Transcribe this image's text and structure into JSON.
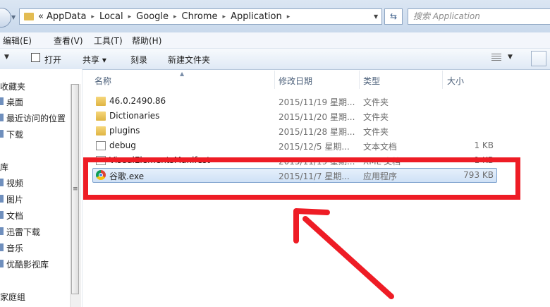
{
  "address": {
    "prefix": "«",
    "segments": [
      "AppData",
      "Local",
      "Google",
      "Chrome",
      "Application"
    ],
    "separator": "▸"
  },
  "search": {
    "placeholder": "搜索 Application"
  },
  "menu": [
    "编辑(E)",
    "查看(V)",
    "工具(T)",
    "帮助(H)"
  ],
  "toolbar": {
    "print": "打开",
    "share": "共享 ▾",
    "burn": "刻录",
    "new_folder": "新建文件夹"
  },
  "nav": {
    "favorites_header": "收藏夹",
    "favorites": [
      "桌面",
      "最近访问的位置",
      "下载"
    ],
    "libraries_header": "库",
    "libraries": [
      "视频",
      "图片",
      "文档",
      "迅雷下载",
      "音乐",
      "优酷影视库"
    ],
    "homegroup_header": "家庭组"
  },
  "columns": {
    "name": "名称",
    "date": "修改日期",
    "type": "类型",
    "size": "大小"
  },
  "files": [
    {
      "name": "46.0.2490.86",
      "date": "2015/11/19 星期...",
      "type": "文件夹",
      "size": "",
      "icon": "folder-icon"
    },
    {
      "name": "Dictionaries",
      "date": "2015/11/20 星期...",
      "type": "文件夹",
      "size": "",
      "icon": "folder-icon"
    },
    {
      "name": "plugins",
      "date": "2015/11/28 星期...",
      "type": "文件夹",
      "size": "",
      "icon": "folder-icon"
    },
    {
      "name": "debug",
      "date": "2015/12/5 星期...",
      "type": "文本文档",
      "size": "1 KB",
      "icon": "text-file-icon"
    },
    {
      "name": "VisualElementsManifest",
      "date": "2015/11/19 星期...",
      "type": "XML 文档",
      "size": "1 KB",
      "icon": "xml-file-icon"
    },
    {
      "name": "谷歌.exe",
      "date": "2015/11/7 星期...",
      "type": "应用程序",
      "size": "793 KB",
      "icon": "chrome-icon"
    }
  ],
  "colors": {
    "highlight": "#ee1c25",
    "selection": "#cfe1f6",
    "folder": "#e3bc52"
  }
}
